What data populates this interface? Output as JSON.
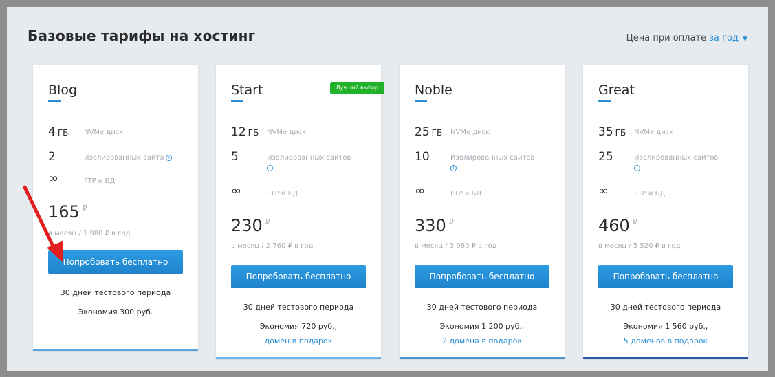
{
  "header": {
    "title": "Базовые тарифы на хостинг",
    "price_prefix": "Цена при оплате",
    "price_period": "за год"
  },
  "colors": {
    "accent": "#2a8fd6",
    "button": "#2490d8",
    "badge": "#22b22a",
    "arrow": "#e31e1e"
  },
  "icons": {
    "info": "info-icon",
    "infinity": "infinity-icon",
    "dropdown": "chevron-down-icon",
    "arrow": "red-arrow-icon"
  },
  "plans": [
    {
      "name": "Blog",
      "disk_value": "4",
      "disk_unit": "ГБ",
      "disk_label": "NVMe диск",
      "sites_value": "2",
      "sites_label": "Изолированных сайта",
      "ftp_value": "∞",
      "ftp_label": "FTP и БД",
      "price": "165",
      "currency": "₽",
      "price_sub": "в месяц / 1 980 ₽ в год",
      "button": "Попробовать бесплатно",
      "trial": "30 дней тестового периода",
      "savings": "Экономия 300 руб.",
      "gift": ""
    },
    {
      "name": "Start",
      "badge": "Лучший выбор",
      "disk_value": "12",
      "disk_unit": "ГБ",
      "disk_label": "NVMe диск",
      "sites_value": "5",
      "sites_label": "Изолированных сайтов",
      "ftp_value": "∞",
      "ftp_label": "FTP и БД",
      "price": "230",
      "currency": "₽",
      "price_sub": "в месяц / 2 760 ₽ в год",
      "button": "Попробовать бесплатно",
      "trial": "30 дней тестового периода",
      "savings": "Экономия 720 руб.,",
      "gift": "домен в подарок"
    },
    {
      "name": "Noble",
      "disk_value": "25",
      "disk_unit": "ГБ",
      "disk_label": "NVMe диск",
      "sites_value": "10",
      "sites_label": "Изолированных сайтов",
      "ftp_value": "∞",
      "ftp_label": "FTP и БД",
      "price": "330",
      "currency": "₽",
      "price_sub": "в месяц / 3 960 ₽ в год",
      "button": "Попробовать бесплатно",
      "trial": "30 дней тестового периода",
      "savings": "Экономия 1 200 руб.,",
      "gift": "2 домена в подарок"
    },
    {
      "name": "Great",
      "disk_value": "35",
      "disk_unit": "ГБ",
      "disk_label": "NVMe диск",
      "sites_value": "25",
      "sites_label": "Изолированных сайтов",
      "ftp_value": "∞",
      "ftp_label": "FTP и БД",
      "price": "460",
      "currency": "₽",
      "price_sub": "в месяц / 5 520 ₽ в год",
      "button": "Попробовать бесплатно",
      "trial": "30 дней тестового периода",
      "savings": "Экономия 1 560 руб.,",
      "gift": "5 доменов в подарок"
    }
  ]
}
